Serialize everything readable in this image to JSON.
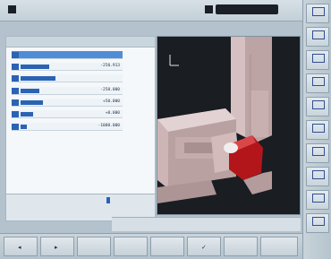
{
  "header": {
    "title": "",
    "subtitle": "",
    "right_label": ""
  },
  "panel": {
    "title": "",
    "axes": [
      {
        "name": "",
        "value": "",
        "fill": 0.92
      },
      {
        "name": "",
        "value": "-250.913",
        "fill": 0.45
      },
      {
        "name": "",
        "value": "",
        "fill": 0.55
      },
      {
        "name": "",
        "value": "-250.000",
        "fill": 0.3
      },
      {
        "name": "",
        "value": "+50.000",
        "fill": 0.35
      },
      {
        "name": "",
        "value": "+0.000",
        "fill": 0.2
      },
      {
        "name": "",
        "value": "-1000.000",
        "fill": 0.1
      }
    ],
    "bottom": {
      "left_top": "",
      "left_bottom": "",
      "mid_top": "",
      "mid_bottom": ""
    }
  },
  "status": {
    "line1": "",
    "line2": ""
  },
  "softkeys_bottom": [
    {
      "label": ""
    },
    {
      "label": ""
    },
    {
      "label": ""
    },
    {
      "label": ""
    },
    {
      "label": ""
    },
    {
      "label": ""
    },
    {
      "label": ""
    },
    {
      "label": ""
    }
  ],
  "softkeys_right": [
    {
      "label": ""
    },
    {
      "label": ""
    },
    {
      "label": ""
    },
    {
      "label": ""
    },
    {
      "label": ""
    },
    {
      "label": ""
    },
    {
      "label": ""
    },
    {
      "label": ""
    },
    {
      "label": ""
    },
    {
      "label": ""
    }
  ],
  "colors": {
    "accent": "#2b63b4",
    "part_red": "#b3161a",
    "machine_pink": "#c9b0b1",
    "view_bg": "#1a1d22"
  }
}
